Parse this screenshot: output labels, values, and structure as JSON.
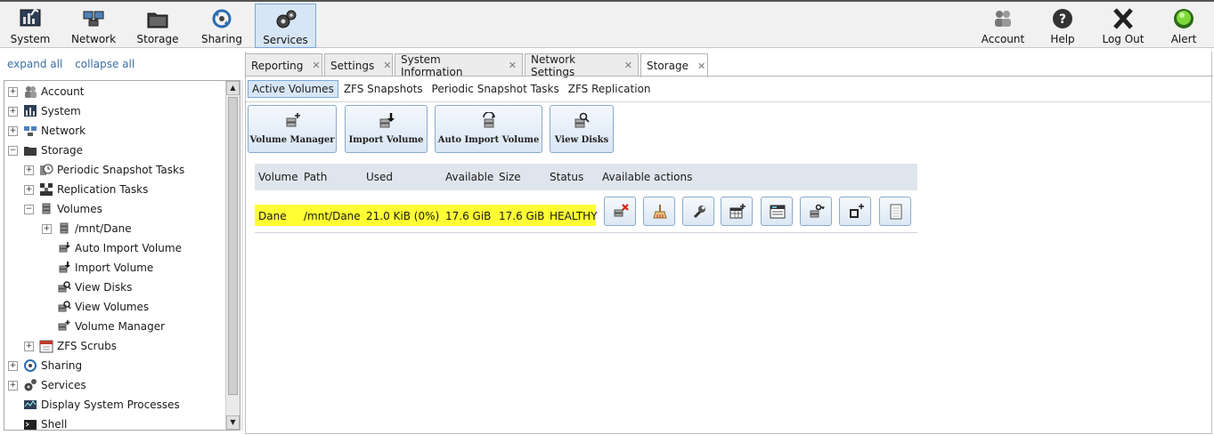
{
  "topbar": {
    "left": [
      {
        "label": "System",
        "icon": "system-icon"
      },
      {
        "label": "Network",
        "icon": "network-icon"
      },
      {
        "label": "Storage",
        "icon": "storage-icon"
      },
      {
        "label": "Sharing",
        "icon": "sharing-icon"
      },
      {
        "label": "Services",
        "icon": "services-icon",
        "active": true
      }
    ],
    "right": [
      {
        "label": "Account",
        "icon": "account-icon"
      },
      {
        "label": "Help",
        "icon": "help-icon"
      },
      {
        "label": "Log Out",
        "icon": "logout-icon"
      },
      {
        "label": "Alert",
        "icon": "alert-icon"
      }
    ]
  },
  "sidebar": {
    "expand_all": "expand all",
    "collapse_all": "collapse all",
    "tree": [
      {
        "label": "Account",
        "expander": "+",
        "icon": "account-icon"
      },
      {
        "label": "System",
        "expander": "+",
        "icon": "system-icon"
      },
      {
        "label": "Network",
        "expander": "+",
        "icon": "network-icon"
      },
      {
        "label": "Storage",
        "expander": "−",
        "icon": "storage-icon"
      },
      {
        "label": "Periodic Snapshot Tasks",
        "expander": "+",
        "icon": "snapshot-task-icon"
      },
      {
        "label": "Replication Tasks",
        "expander": "+",
        "icon": "replication-icon"
      },
      {
        "label": "Volumes",
        "expander": "−",
        "icon": "volume-icon"
      },
      {
        "label": "/mnt/Dane",
        "expander": "+",
        "icon": "volume-icon"
      },
      {
        "label": "Auto Import Volume",
        "expander": "",
        "icon": "auto-import-icon"
      },
      {
        "label": "Import Volume",
        "expander": "",
        "icon": "import-icon"
      },
      {
        "label": "View Disks",
        "expander": "",
        "icon": "view-disks-icon"
      },
      {
        "label": "View Volumes",
        "expander": "",
        "icon": "view-volumes-icon"
      },
      {
        "label": "Volume Manager",
        "expander": "",
        "icon": "volume-manager-icon"
      },
      {
        "label": "ZFS Scrubs",
        "expander": "+",
        "icon": "calendar-icon"
      },
      {
        "label": "Sharing",
        "expander": "+",
        "icon": "sharing-icon"
      },
      {
        "label": "Services",
        "expander": "+",
        "icon": "services-icon"
      },
      {
        "label": "Display System Processes",
        "expander": "",
        "icon": "processes-icon"
      },
      {
        "label": "Shell",
        "expander": "",
        "icon": "shell-icon"
      }
    ]
  },
  "tabs": [
    {
      "label": "Reporting"
    },
    {
      "label": "Settings"
    },
    {
      "label": "System Information"
    },
    {
      "label": "Network Settings"
    },
    {
      "label": "Storage",
      "active": true
    }
  ],
  "subtabs": [
    {
      "label": "Active Volumes",
      "active": true
    },
    {
      "label": "ZFS Snapshots"
    },
    {
      "label": "Periodic Snapshot Tasks"
    },
    {
      "label": "ZFS Replication"
    }
  ],
  "actions": [
    {
      "label": "Volume Manager",
      "icon": "volume-manager-icon"
    },
    {
      "label": "Import Volume",
      "icon": "import-icon"
    },
    {
      "label": "Auto Import Volume",
      "icon": "auto-import-icon"
    },
    {
      "label": "View Disks",
      "icon": "view-disks-icon"
    }
  ],
  "volumes_table": {
    "headers": [
      "Volume",
      "Path",
      "Used",
      "Available",
      "Size",
      "Status",
      "Available actions"
    ],
    "rows": [
      {
        "volume": "Dane",
        "path": "/mnt/Dane",
        "used": "21.0 KiB (0%)",
        "available": "17.6 GiB",
        "size": "17.6 GiB",
        "status": "HEALTHY"
      }
    ],
    "row_action_icons": [
      "detach-volume-icon",
      "scrub-volume-icon",
      "edit-zfs-options-icon",
      "create-zfs-dataset-icon",
      "create-zvol-icon",
      "change-permissions-icon",
      "create-snapshot-icon",
      "volume-status-icon"
    ]
  },
  "colors": {
    "highlight": "#ffff33",
    "active_bg": "#d7e6f7",
    "active_border": "#7ba7d8"
  }
}
